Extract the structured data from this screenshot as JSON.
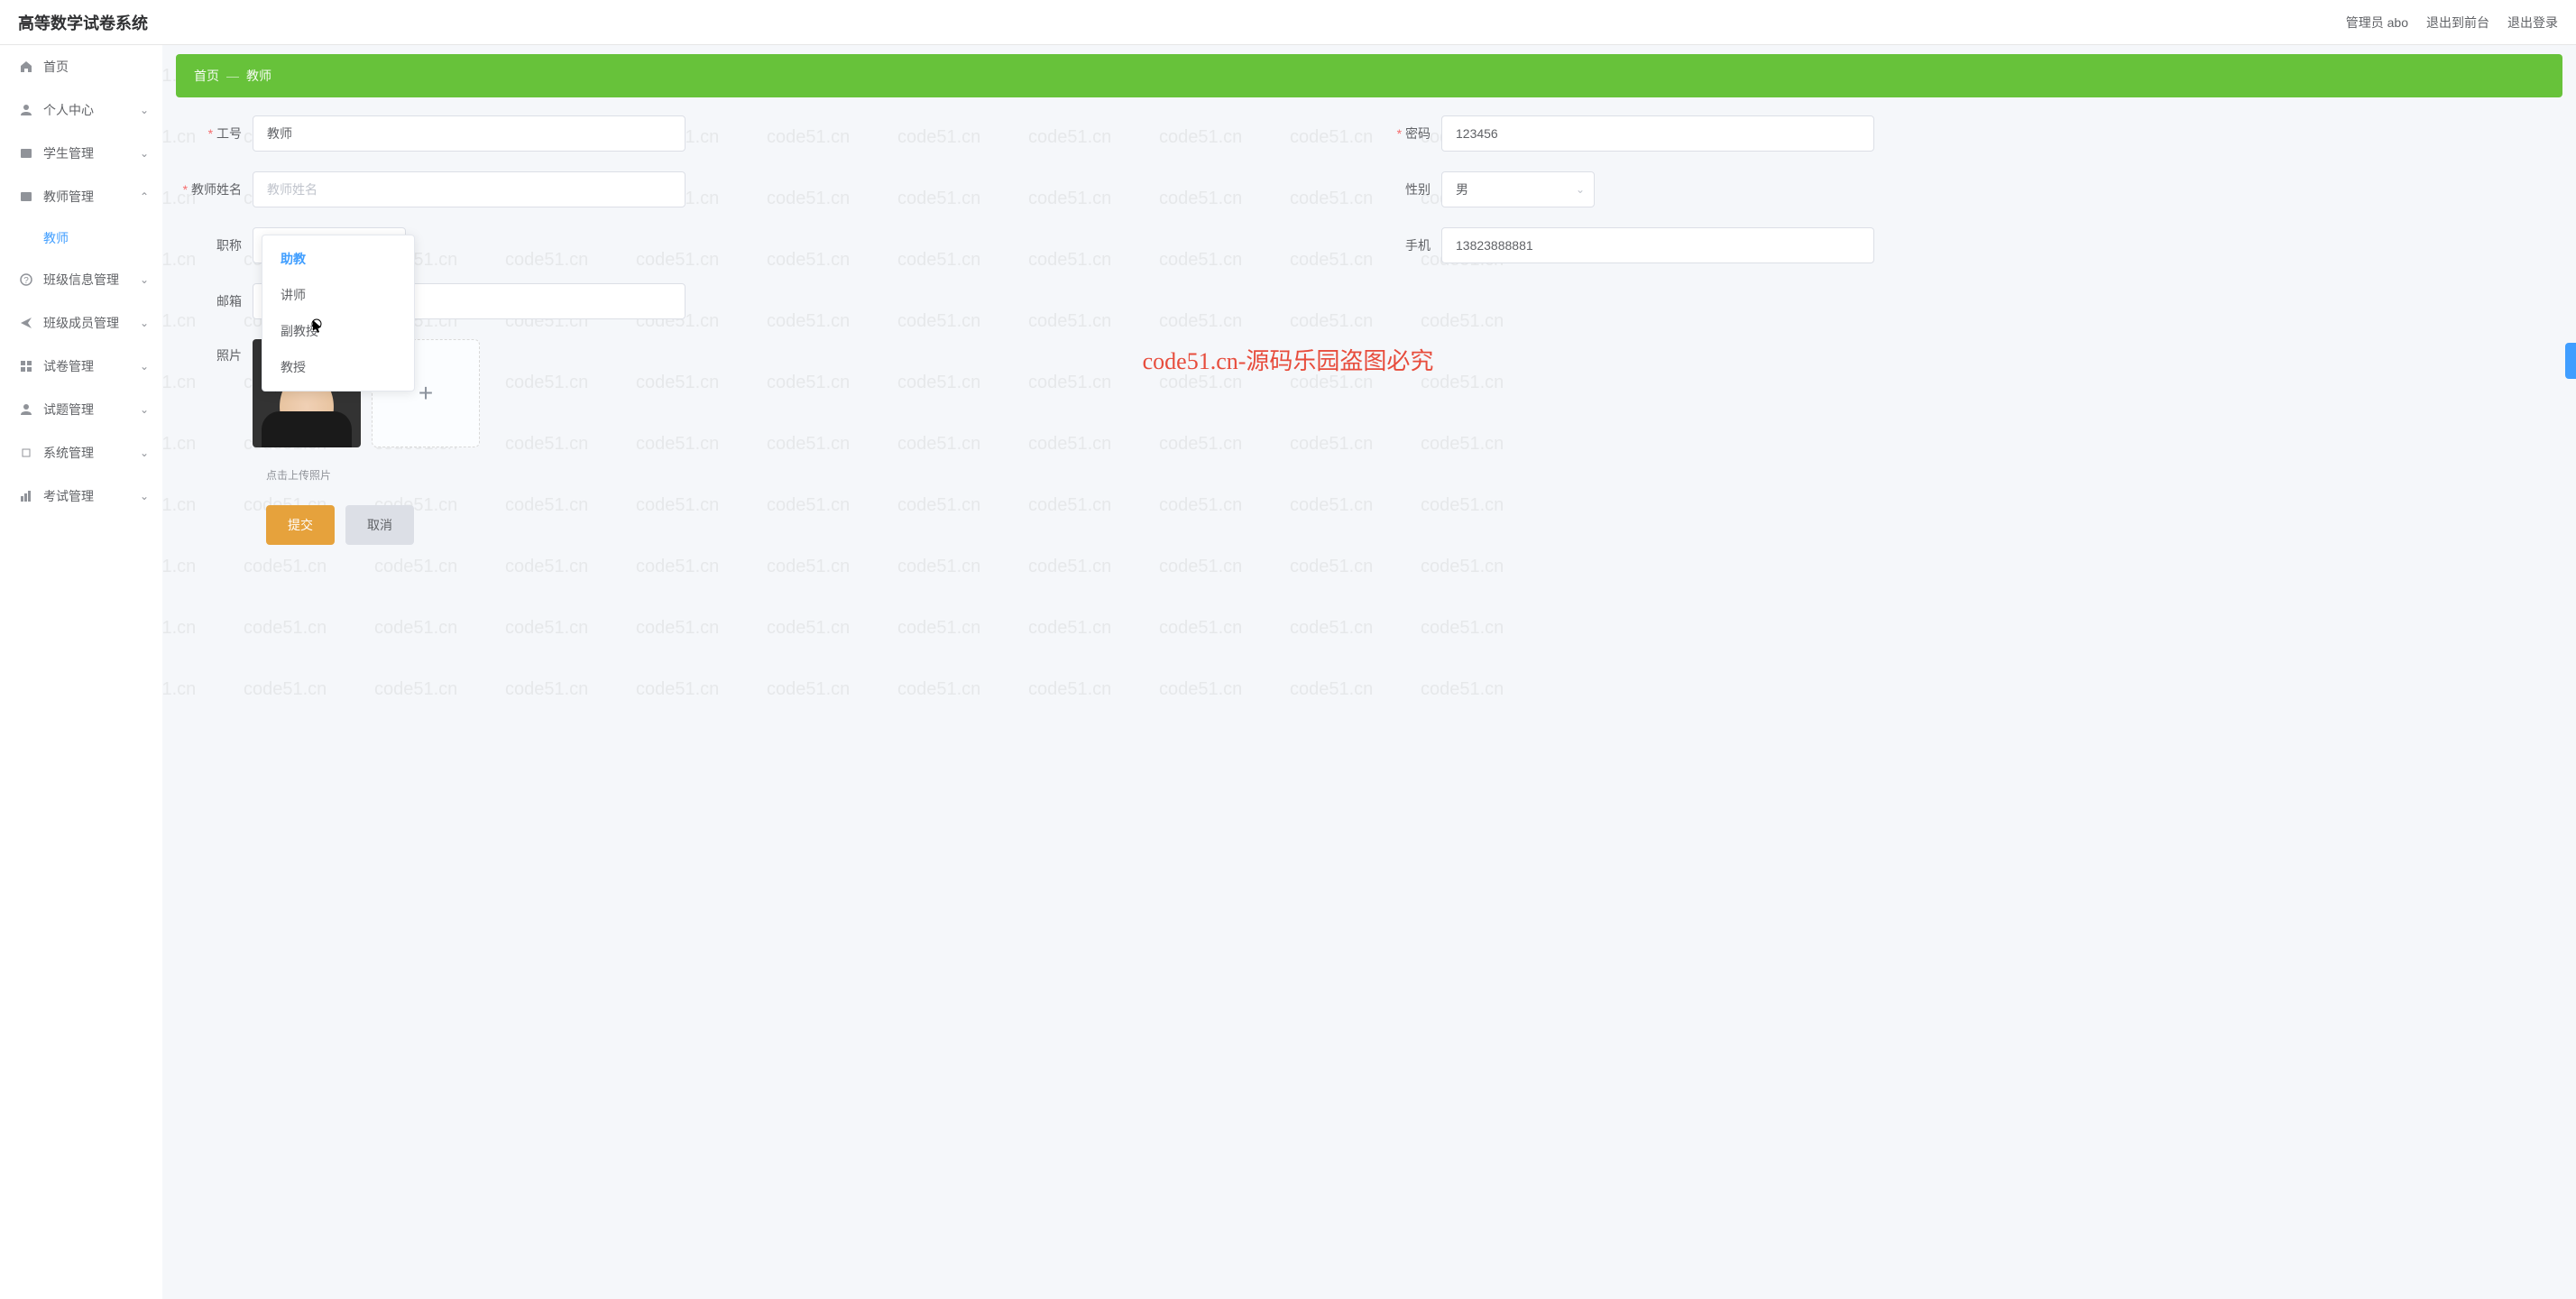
{
  "header": {
    "title": "高等数学试卷系统",
    "admin_label": "管理员 abo",
    "exit_front_label": "退出到前台",
    "logout_label": "退出登录"
  },
  "sidebar": {
    "items": [
      {
        "icon": "home",
        "label": "首页",
        "expandable": false
      },
      {
        "icon": "user",
        "label": "个人中心",
        "expandable": true
      },
      {
        "icon": "users",
        "label": "学生管理",
        "expandable": true
      },
      {
        "icon": "teacher",
        "label": "教师管理",
        "expandable": true,
        "expanded": true,
        "children": [
          {
            "label": "教师"
          }
        ]
      },
      {
        "icon": "help",
        "label": "班级信息管理",
        "expandable": true
      },
      {
        "icon": "send",
        "label": "班级成员管理",
        "expandable": true
      },
      {
        "icon": "grid",
        "label": "试卷管理",
        "expandable": true
      },
      {
        "icon": "person",
        "label": "试题管理",
        "expandable": true
      },
      {
        "icon": "settings",
        "label": "系统管理",
        "expandable": true
      },
      {
        "icon": "chart",
        "label": "考试管理",
        "expandable": true
      }
    ]
  },
  "breadcrumb": {
    "home": "首页",
    "current": "教师"
  },
  "form": {
    "employee_id": {
      "label": "工号",
      "value": "教师"
    },
    "password": {
      "label": "密码",
      "value": "123456"
    },
    "teacher_name": {
      "label": "教师姓名",
      "placeholder": "教师姓名",
      "value": ""
    },
    "gender": {
      "label": "性别",
      "value": "男"
    },
    "title": {
      "label": "职称",
      "value": "助教"
    },
    "phone": {
      "label": "手机",
      "value": "13823888881"
    },
    "email": {
      "label": "邮箱",
      "value": ""
    },
    "photo": {
      "label": "照片"
    },
    "upload_tip": "点击上传照片",
    "submit_label": "提交",
    "cancel_label": "取消"
  },
  "dropdown": {
    "options": [
      "助教",
      "讲师",
      "副教授",
      "教授"
    ],
    "selected": "助教"
  },
  "watermark": {
    "text": "code51.cn",
    "center": "code51.cn-源码乐园盗图必究"
  }
}
